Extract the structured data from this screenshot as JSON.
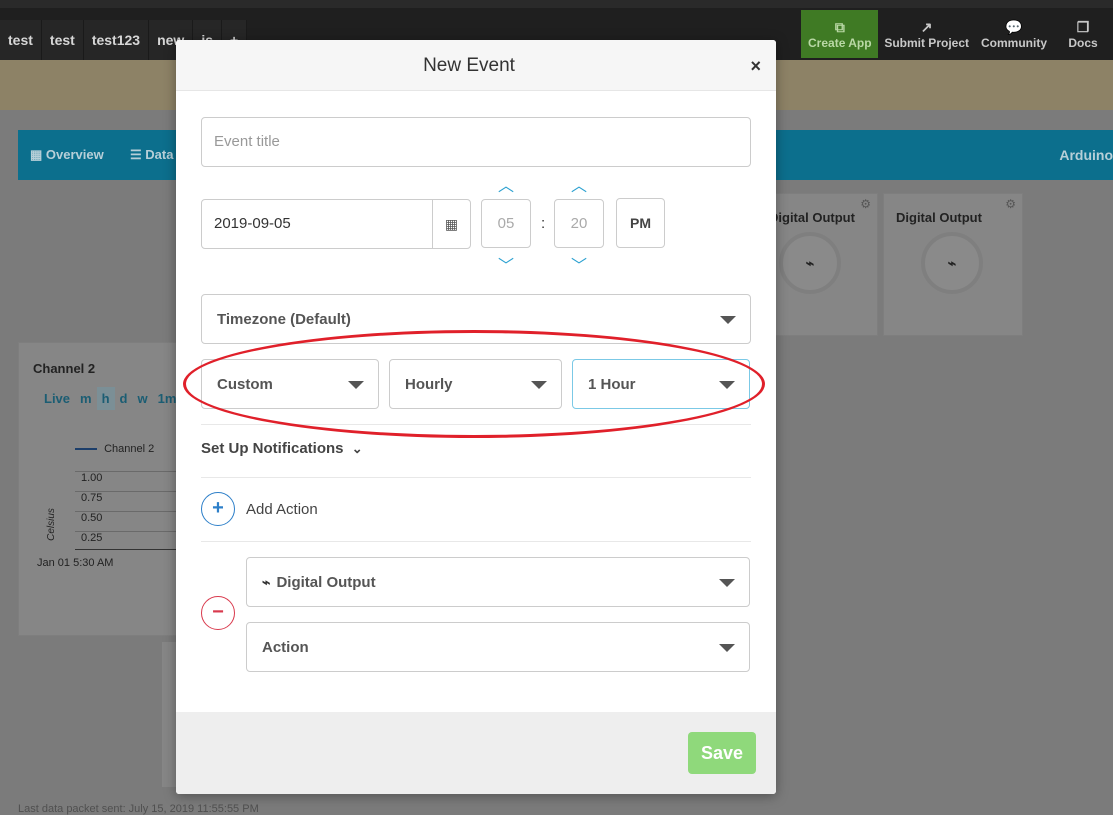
{
  "tabs": [
    "test",
    "test",
    "test123",
    "new",
    "js",
    "+"
  ],
  "topnav": {
    "create_app": "Create App",
    "submit_project": "Submit Project",
    "community": "Community",
    "docs": "Docs"
  },
  "app_header": {
    "overview": "Overview",
    "data": "Data",
    "device_name": "Arduino"
  },
  "widgets": {
    "digital_output_1": "Digital Output",
    "digital_output_2": "Digital Output",
    "knob_icon": "wave-output-icon"
  },
  "chart_widget": {
    "title": "Channel 2",
    "ranges": [
      "Live",
      "m",
      "h",
      "d",
      "w",
      "1m"
    ],
    "selected_range": "h",
    "chart_data": {
      "type": "line",
      "series": [
        {
          "name": "Channel 2",
          "values": []
        }
      ],
      "yticks": [
        "1.00",
        "0.75",
        "0.50",
        "0.25"
      ],
      "ylabel": "Celsius",
      "xticks": [
        "Jan 01 5:30 AM"
      ]
    }
  },
  "footer": {
    "last_packet": "Last data packet sent: July 15, 2019 11:55:55 PM"
  },
  "modal": {
    "title": "New Event",
    "close": "×",
    "event_title_placeholder": "Event title",
    "date_value": "2019-09-05",
    "hour": "05",
    "minute": "20",
    "colon": ":",
    "ampm": "PM",
    "timezone": "Timezone (Default)",
    "repeat_mode": "Custom",
    "frequency": "Hourly",
    "interval": "1 Hour",
    "notifications": "Set Up Notifications",
    "add_action": "Add Action",
    "action_device": "Digital Output",
    "action_select": "Action",
    "save": "Save"
  },
  "colors": {
    "accent": "#2aa0d0",
    "save_green": "#8fd97b",
    "remove_red": "#d93a4d",
    "add_blue": "#2d7fc9",
    "annotation_red": "#e0202a"
  }
}
